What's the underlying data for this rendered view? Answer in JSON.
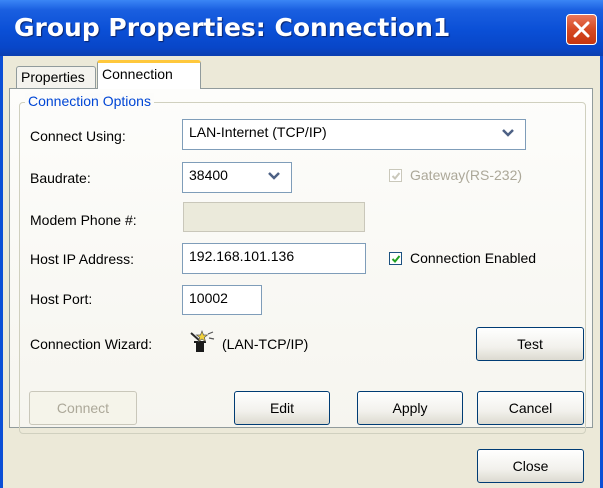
{
  "window": {
    "title": "Group Properties: Connection1",
    "close_icon": "close-icon"
  },
  "tabs": [
    {
      "label": "Properties",
      "selected": false
    },
    {
      "label": "Connection",
      "selected": true
    }
  ],
  "group": {
    "legend": "Connection Options"
  },
  "form": {
    "connect_using": {
      "label": "Connect Using:",
      "value": "LAN-Internet (TCP/IP)"
    },
    "baudrate": {
      "label": "Baudrate:",
      "value": "38400"
    },
    "gateway": {
      "label": "Gateway(RS-232)",
      "checked": true,
      "enabled": false
    },
    "modem_phone": {
      "label": "Modem Phone #:",
      "value": "",
      "enabled": false
    },
    "host_ip": {
      "label": "Host IP Address:",
      "value": "192.168.101.136"
    },
    "connection_enabled": {
      "label": "Connection Enabled",
      "checked": true
    },
    "host_port": {
      "label": "Host Port:",
      "value": "10002"
    },
    "wizard": {
      "label": "Connection Wizard:",
      "value": "(LAN-TCP/IP)",
      "icon": "wizard-icon"
    }
  },
  "buttons": {
    "test": "Test",
    "connect": "Connect",
    "edit": "Edit",
    "apply": "Apply",
    "cancel": "Cancel",
    "close": "Close"
  },
  "colors": {
    "titlebar": "#0a4fd6",
    "close_button": "#d64a23",
    "tab_highlight": "#ffc83c",
    "group_legend": "#0046d5",
    "dialog_background": "#ece9d8"
  }
}
